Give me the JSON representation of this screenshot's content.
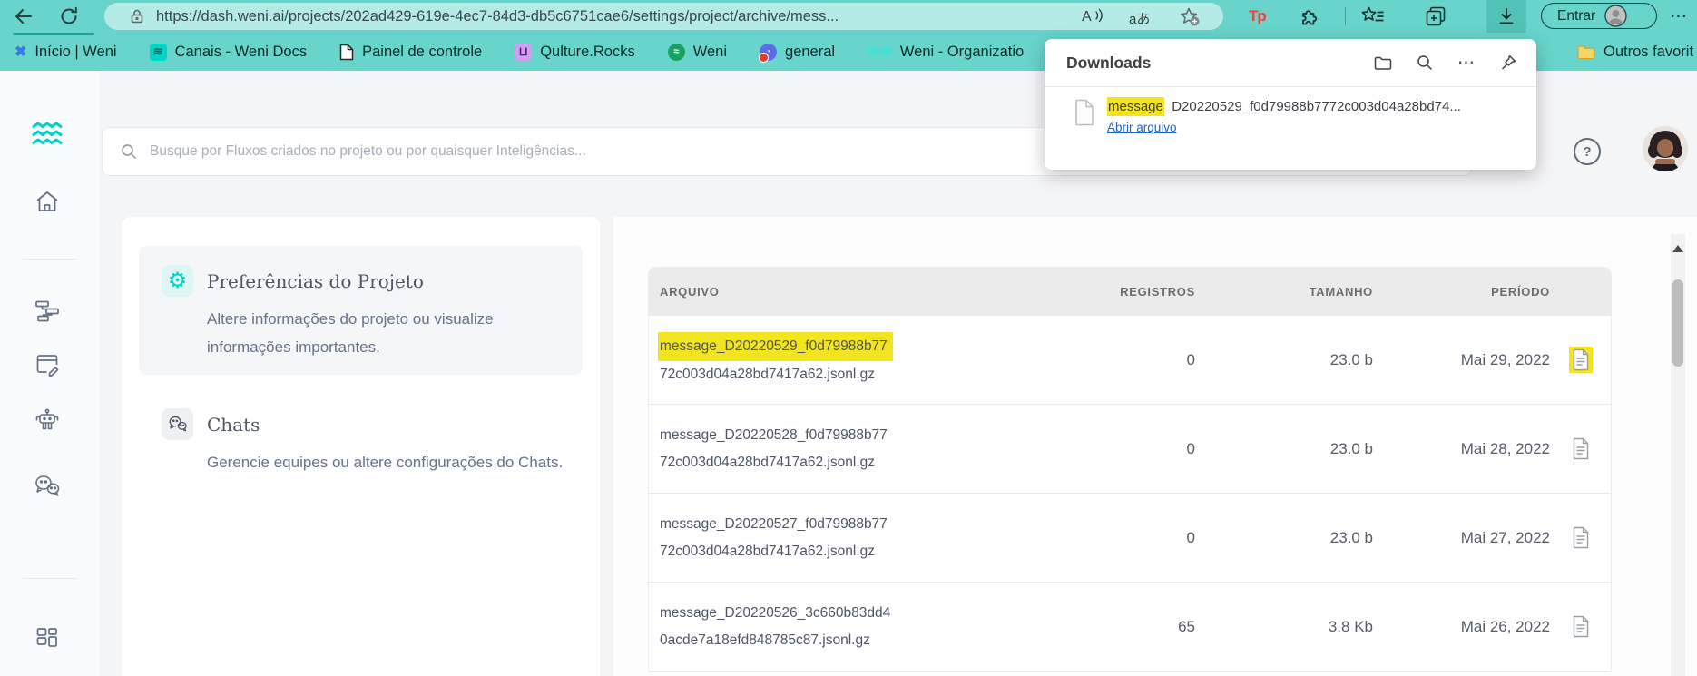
{
  "browser": {
    "url": "https://dash.weni.ai/projects/202ad429-619e-4ec7-84d3-db5c6751cae6/settings/project/archive/mess...",
    "translate_label": "aあ",
    "tp_label": "Tp",
    "entrar_label": "Entrar",
    "menu_dots": "⋯",
    "bookmarks": [
      {
        "icon": "weni-x",
        "label": "Início | Weni"
      },
      {
        "icon": "weni-docs",
        "label": "Canais - Weni Docs"
      },
      {
        "icon": "page",
        "label": "Painel de controle"
      },
      {
        "icon": "qulture",
        "label": "Qulture.Rocks"
      },
      {
        "icon": "weni-green",
        "label": "Weni"
      },
      {
        "icon": "chat-general",
        "label": "general"
      },
      {
        "icon": "weni-waves",
        "label": "Weni - Organizatio"
      }
    ],
    "others_label": "Outros favorit"
  },
  "downloads_popup": {
    "title": "Downloads",
    "file_highlight": "message",
    "file_rest": "_D20220529_f0d79988b7772c003d04a28bd74...",
    "open_label": "Abrir arquivo",
    "dots": "⋯"
  },
  "app": {
    "search_placeholder": "Busque por Fluxos criados no projeto ou por quaisquer Inteligências...",
    "help_glyph": "?",
    "gear_glyph": "⚙",
    "nav": [
      {
        "title": "Preferências do Projeto",
        "description": "Altere informações do projeto ou visualize informações importantes."
      },
      {
        "title": "Chats",
        "description": "Gerencie equipes ou altere configurações do Chats."
      }
    ],
    "table": {
      "columns": [
        "ARQUIVO",
        "REGISTROS",
        "TAMANHO",
        "PERÍODO"
      ],
      "rows": [
        {
          "file_line1": "message_D20220529_f0d79988b77",
          "file_line2": "72c003d04a28bd7417a62.jsonl.gz",
          "registros": "0",
          "tamanho": "23.0 b",
          "periodo": "Mai 29, 2022",
          "highlighted": true
        },
        {
          "file_line1": "message_D20220528_f0d79988b77",
          "file_line2": "72c003d04a28bd7417a62.jsonl.gz",
          "registros": "0",
          "tamanho": "23.0 b",
          "periodo": "Mai 28, 2022",
          "highlighted": false
        },
        {
          "file_line1": "message_D20220527_f0d79988b77",
          "file_line2": "72c003d04a28bd7417a62.jsonl.gz",
          "registros": "0",
          "tamanho": "23.0 b",
          "periodo": "Mai 27, 2022",
          "highlighted": false
        },
        {
          "file_line1": "message_D20220526_3c660b83dd4",
          "file_line2": "0acde7a18efd848785c87.jsonl.gz",
          "registros": "65",
          "tamanho": "3.8 Kb",
          "periodo": "Mai 26, 2022",
          "highlighted": false
        }
      ]
    }
  },
  "colors": {
    "browser_teal": "#68d4cb",
    "address_pill": "#b5ebe6",
    "accent_teal": "#00d1c5",
    "highlight_yellow": "#f2e41e",
    "link_blue": "#1866c5"
  }
}
